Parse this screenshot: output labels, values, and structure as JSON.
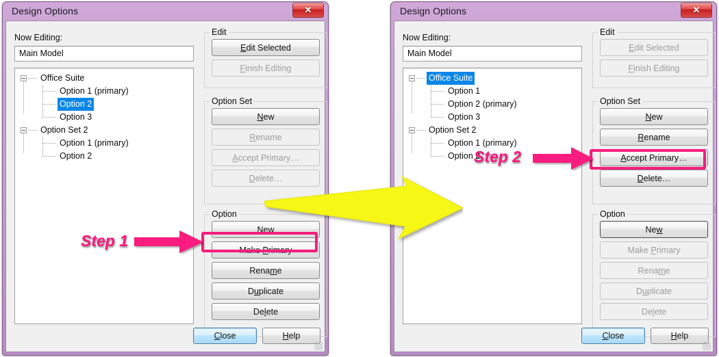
{
  "window_title": "Design Options",
  "close_icon": "window-close-x",
  "labels": {
    "now_editing": "Now Editing:",
    "edit_group": "Edit",
    "option_set_group": "Option Set",
    "option_group": "Option"
  },
  "left_dialog": {
    "now_editing_value": "Main Model",
    "tree": [
      {
        "label": "Office Suite",
        "level": 0,
        "selected": false,
        "expander": true
      },
      {
        "label": "Option 1 (primary)",
        "level": 1,
        "selected": false,
        "expander": false
      },
      {
        "label": "Option 2",
        "level": 1,
        "selected": true,
        "expander": false
      },
      {
        "label": "Option 3",
        "level": 1,
        "selected": false,
        "expander": false
      },
      {
        "label": "Option Set 2",
        "level": 0,
        "selected": false,
        "expander": true
      },
      {
        "label": "Option 1 (primary)",
        "level": 1,
        "selected": false,
        "expander": false
      },
      {
        "label": "Option 2",
        "level": 1,
        "selected": false,
        "expander": false
      }
    ],
    "edit_buttons": [
      {
        "label": "Edit Selected",
        "mnemonic": "E",
        "enabled": true
      },
      {
        "label": "Finish Editing",
        "mnemonic": "F",
        "enabled": false
      }
    ],
    "option_set_buttons": [
      {
        "label": "New",
        "mnemonic": "N",
        "enabled": true
      },
      {
        "label": "Rename",
        "mnemonic": "R",
        "enabled": false
      },
      {
        "label": "Accept Primary…",
        "mnemonic": "A",
        "enabled": false
      },
      {
        "label": "Delete…",
        "mnemonic": "D",
        "enabled": false
      }
    ],
    "option_buttons": [
      {
        "label": "New",
        "mnemonic": "w",
        "enabled": true,
        "highlighted": false
      },
      {
        "label": "Make Primary",
        "mnemonic": "P",
        "enabled": true,
        "highlighted": true
      },
      {
        "label": "Rename",
        "mnemonic": "m",
        "enabled": true,
        "highlighted": false
      },
      {
        "label": "Duplicate",
        "mnemonic": "u",
        "enabled": true,
        "highlighted": false
      },
      {
        "label": "Delete",
        "mnemonic": "l",
        "enabled": true,
        "highlighted": false
      }
    ],
    "close_label": "Close",
    "help_label": "Help"
  },
  "right_dialog": {
    "now_editing_value": "Main Model",
    "tree": [
      {
        "label": "Office Suite",
        "level": 0,
        "selected": true,
        "expander": true
      },
      {
        "label": "Option 1",
        "level": 1,
        "selected": false,
        "expander": false
      },
      {
        "label": "Option 2 (primary)",
        "level": 1,
        "selected": false,
        "expander": false
      },
      {
        "label": "Option 3",
        "level": 1,
        "selected": false,
        "expander": false
      },
      {
        "label": "Option Set 2",
        "level": 0,
        "selected": false,
        "expander": true
      },
      {
        "label": "Option 1 (primary)",
        "level": 1,
        "selected": false,
        "expander": false
      },
      {
        "label": "Option 2",
        "level": 1,
        "selected": false,
        "expander": false
      }
    ],
    "edit_buttons": [
      {
        "label": "Edit Selected",
        "mnemonic": "E",
        "enabled": false
      },
      {
        "label": "Finish Editing",
        "mnemonic": "F",
        "enabled": false
      }
    ],
    "option_set_buttons": [
      {
        "label": "New",
        "mnemonic": "N",
        "enabled": true,
        "highlighted": false
      },
      {
        "label": "Rename",
        "mnemonic": "R",
        "enabled": true,
        "highlighted": false
      },
      {
        "label": "Accept Primary…",
        "mnemonic": "A",
        "enabled": true,
        "highlighted": true
      },
      {
        "label": "Delete…",
        "mnemonic": "D",
        "enabled": true,
        "highlighted": false
      }
    ],
    "option_buttons": [
      {
        "label": "New",
        "mnemonic": "w",
        "enabled": true,
        "focused": true
      },
      {
        "label": "Make Primary",
        "mnemonic": "P",
        "enabled": false
      },
      {
        "label": "Rename",
        "mnemonic": "m",
        "enabled": false
      },
      {
        "label": "Duplicate",
        "mnemonic": "u",
        "enabled": false
      },
      {
        "label": "Delete",
        "mnemonic": "l",
        "enabled": false
      }
    ],
    "close_label": "Close",
    "help_label": "Help"
  },
  "annotations": {
    "step1": "Step 1",
    "step2": "Step 2",
    "arrow_color_pink": "#fa1b7e",
    "arrow_color_yellow": "#f7f715",
    "highlight_color": "#f51d7e",
    "selection_color": "#0b86e8"
  }
}
